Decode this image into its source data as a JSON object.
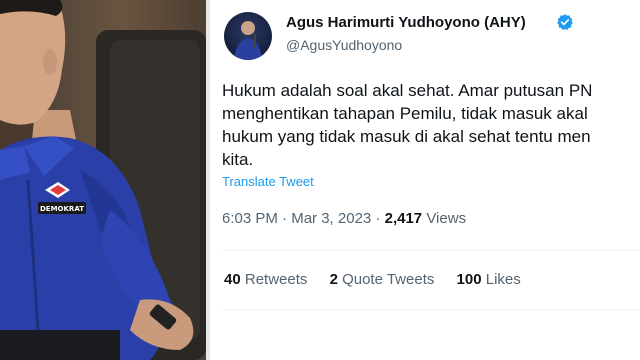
{
  "author": {
    "display_name": "Agus Harimurti Yudhoyono (AHY)",
    "handle": "@AgusYudhoyono",
    "verified": true
  },
  "tweet": {
    "lines": [
      "Hukum adalah soal akal sehat. Amar putusan PN",
      "menghentikan tahapan Pemilu, tidak masuk akal",
      "hukum yang tidak masuk di akal sehat tentu men",
      "kita."
    ],
    "translate_label": "Translate Tweet",
    "time": "6:03 PM",
    "date": "Mar 3, 2023",
    "separator": "·",
    "views_count": "2,417",
    "views_label": "Views"
  },
  "stats": {
    "retweets": {
      "count": "40",
      "label": "Retweets"
    },
    "quote_tweets": {
      "count": "2",
      "label": "Quote Tweets"
    },
    "likes": {
      "count": "100",
      "label": "Likes"
    }
  },
  "photo": {
    "badge_text": "DEMOKRAT"
  },
  "colors": {
    "link_blue": "#1d9bf0",
    "verified_blue": "#1d9bf0",
    "secondary_text": "#536471",
    "shirt_blue": "#2b3fa8"
  },
  "icons": [
    "verified-badge-icon"
  ]
}
